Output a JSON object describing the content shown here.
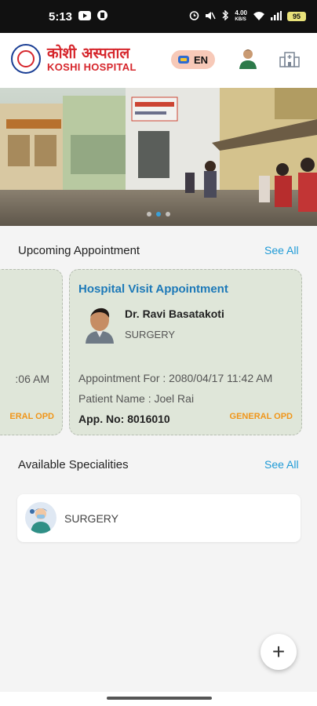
{
  "status_bar": {
    "time": "5:13",
    "speed": "4.00",
    "speed_unit": "KB/S",
    "battery": "95",
    "icons": [
      "youtube-icon",
      "notification-icon",
      "alarm-icon",
      "mute-icon",
      "bluetooth-icon",
      "wifi-icon",
      "signal-icon",
      "battery-icon"
    ]
  },
  "header": {
    "brand_nepali": "कोशी अस्पताल",
    "brand_english": "KOSHI HOSPITAL",
    "language": "EN",
    "icons": [
      "logo-icon",
      "language-flag-icon",
      "user-avatar-icon",
      "hospital-icon"
    ]
  },
  "banner": {
    "slide_count": 3,
    "active_slide": 2
  },
  "upcoming": {
    "title": "Upcoming Appointment",
    "see_all": "See All",
    "partial_card": {
      "time_fragment": ":06 AM",
      "opd_fragment": "ERAL OPD"
    },
    "card": {
      "title": "Hospital Visit Appointment",
      "doctor_name": "Dr. Ravi Basatakoti",
      "department": "SURGERY",
      "appointment_for": "Appointment For : 2080/04/17 11:42 AM",
      "patient_name": "Patient Name : Joel Rai",
      "app_no": "App. No: 8016010",
      "opd": "GENERAL OPD"
    }
  },
  "specialities": {
    "title": "Available Specialities",
    "see_all": "See All",
    "items": [
      {
        "label": "SURGERY",
        "icon": "surgeon-icon"
      }
    ]
  },
  "fab": {
    "label": "+",
    "icon": "plus-icon"
  },
  "colors": {
    "accent": "#1e9ad6",
    "brand_red": "#d6262c",
    "card_bg": "#dfe6d9",
    "opd_orange": "#f0961a",
    "title_blue": "#1d79b8"
  }
}
